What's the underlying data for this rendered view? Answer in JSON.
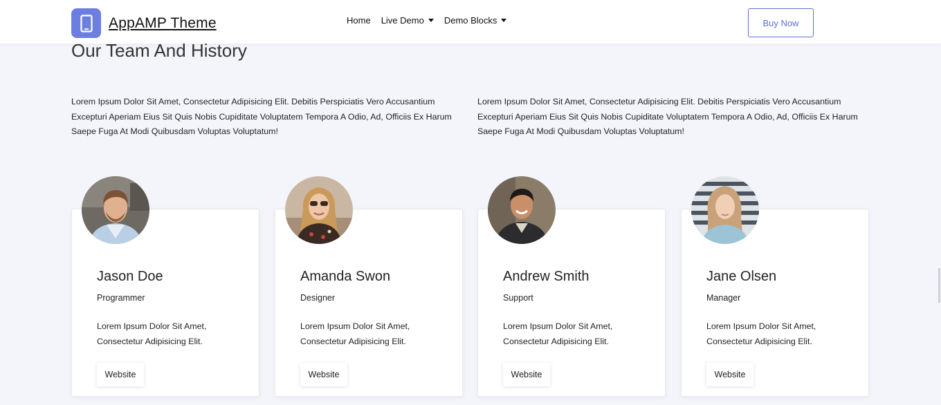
{
  "header": {
    "brand_name": "AppAMP Theme",
    "logo_icon": "phone-icon",
    "nav": [
      {
        "label": "Home",
        "has_dropdown": false
      },
      {
        "label": "Live Demo",
        "has_dropdown": true
      },
      {
        "label": "Demo Blocks",
        "has_dropdown": true
      }
    ],
    "buy_label": "Buy Now"
  },
  "section": {
    "title": "Our Team And History",
    "intro_left": "Lorem Ipsum Dolor Sit Amet, Consectetur Adipisicing Elit. Debitis Perspiciatis Vero Accusantium Excepturi Aperiam Eius Sit Quis Nobis Cupiditate Voluptatem Tempora A Odio, Ad, Officiis Ex Harum Saepe Fuga At Modi Quibusdam Voluptas Voluptatum!",
    "intro_right": "Lorem Ipsum Dolor Sit Amet, Consectetur Adipisicing Elit. Debitis Perspiciatis Vero Accusantium Excepturi Aperiam Eius Sit Quis Nobis Cupiditate Voluptatem Tempora A Odio, Ad, Officiis Ex Harum Saepe Fuga At Modi Quibusdam Voluptas Voluptatum!"
  },
  "team": [
    {
      "name": "Jason Doe",
      "role": "Programmer",
      "bio": "Lorem Ipsum Dolor Sit Amet, Consectetur Adipisicing Elit.",
      "button": "Website"
    },
    {
      "name": "Amanda Swon",
      "role": "Designer",
      "bio": "Lorem Ipsum Dolor Sit Amet, Consectetur Adipisicing Elit.",
      "button": "Website"
    },
    {
      "name": "Andrew Smith",
      "role": "Support",
      "bio": "Lorem Ipsum Dolor Sit Amet, Consectetur Adipisicing Elit.",
      "button": "Website"
    },
    {
      "name": "Jane Olsen",
      "role": "Manager",
      "bio": "Lorem Ipsum Dolor Sit Amet, Consectetur Adipisicing Elit.",
      "button": "Website"
    }
  ],
  "colors": {
    "accent": "#5a6fd8",
    "logo_bg": "#6c7fe0",
    "page_bg": "#f4f5fb"
  }
}
